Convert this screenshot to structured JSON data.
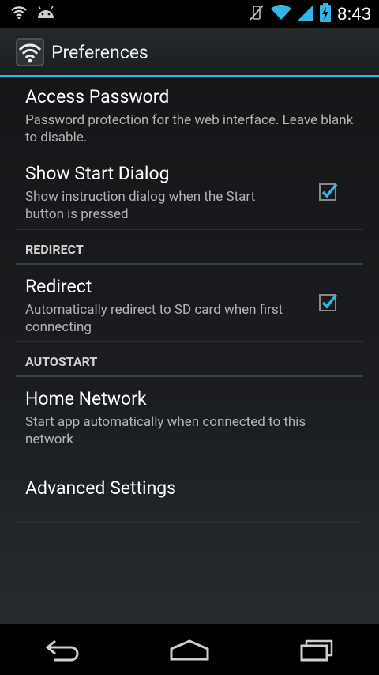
{
  "status_bar": {
    "time": "8:43",
    "left_icons": [
      "wifi-icon",
      "android-icon"
    ],
    "right_icons": [
      "mute-vibrate-icon",
      "wifi-signal-icon",
      "cell-signal-icon",
      "battery-charging-icon"
    ]
  },
  "action_bar": {
    "title": "Preferences",
    "icon": "wifi-app-icon"
  },
  "preferences": {
    "access_password": {
      "title": "Access Password",
      "summary": "Password protection for the web interface. Leave blank to disable."
    },
    "show_start_dialog": {
      "title": "Show Start Dialog",
      "summary": "Show instruction dialog when the Start button is pressed",
      "checked": true
    },
    "redirect_category": "REDIRECT",
    "redirect": {
      "title": "Redirect",
      "summary": "Automatically redirect to SD card when first connecting",
      "checked": true
    },
    "autostart_category": "AUTOSTART",
    "home_network": {
      "title": "Home Network",
      "summary": "Start app automatically when connected to this network"
    },
    "advanced_settings": {
      "title": "Advanced Settings"
    }
  },
  "nav_bar": {
    "buttons": [
      "back-icon",
      "home-icon",
      "recents-icon"
    ]
  },
  "colors": {
    "accent": "#33b5e5",
    "background": "#101214"
  }
}
